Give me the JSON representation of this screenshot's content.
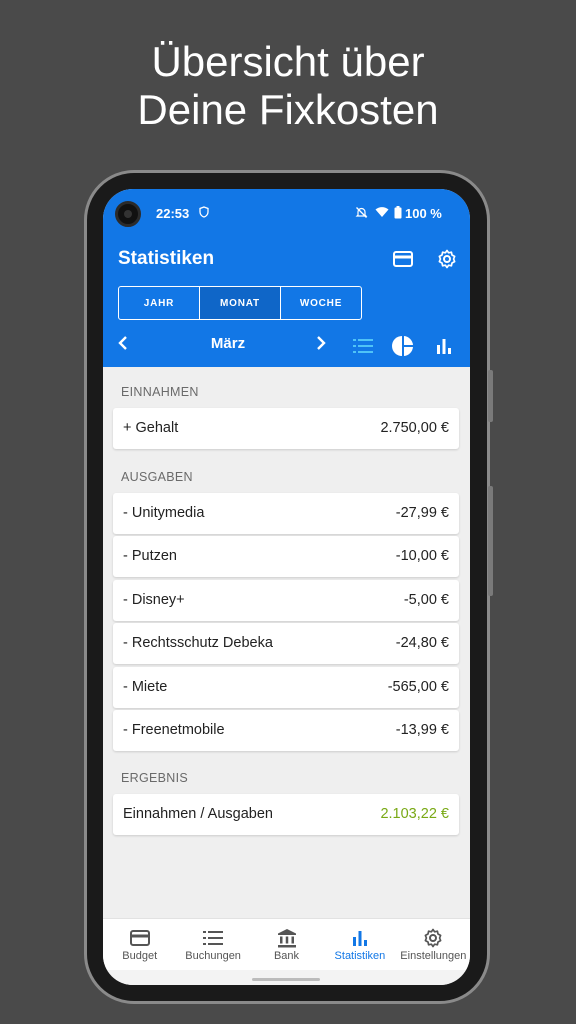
{
  "headline": {
    "line1": "Übersicht über",
    "line2": "Deine Fixkosten"
  },
  "statusbar": {
    "time": "22:53",
    "battery": "100 %"
  },
  "appbar": {
    "title": "Statistiken",
    "icons": [
      "card-icon",
      "gear-icon"
    ],
    "accent": "#1277e6"
  },
  "period_tabs": [
    {
      "label": "JAHR",
      "active": false
    },
    {
      "label": "MONAT",
      "active": true
    },
    {
      "label": "WOCHE",
      "active": false
    }
  ],
  "month_nav": {
    "month": "März",
    "view_icons": [
      "list-icon",
      "pie-chart-icon",
      "bar-chart-icon"
    ],
    "active_view": "list-icon"
  },
  "sections": {
    "income": {
      "title": "EINNAHMEN",
      "rows": [
        {
          "label": "+ Gehalt",
          "value": "2.750,00 €"
        }
      ]
    },
    "expenses": {
      "title": "AUSGABEN",
      "rows": [
        {
          "label": "- Unitymedia",
          "value": "-27,99 €"
        },
        {
          "label": "- Putzen",
          "value": "-10,00 €"
        },
        {
          "label": "- Disney+",
          "value": "-5,00 €"
        },
        {
          "label": "- Rechtsschutz Debeka",
          "value": "-24,80 €"
        },
        {
          "label": "- Miete",
          "value": "-565,00 €"
        },
        {
          "label": "- Freenetmobile",
          "value": "-13,99 €"
        }
      ]
    },
    "result": {
      "title": "ERGEBNIS",
      "rows": [
        {
          "label": "Einnahmen / Ausgaben",
          "value": "2.103,22 €",
          "color": "#79a915"
        }
      ]
    }
  },
  "bottom_nav": [
    {
      "label": "Budget",
      "icon": "card-icon",
      "active": false
    },
    {
      "label": "Buchungen",
      "icon": "list-icon",
      "active": false
    },
    {
      "label": "Bank",
      "icon": "bank-icon",
      "active": false
    },
    {
      "label": "Statistiken",
      "icon": "bar-chart-icon",
      "active": true
    },
    {
      "label": "Einstellungen",
      "icon": "gear-icon",
      "active": false
    }
  ]
}
